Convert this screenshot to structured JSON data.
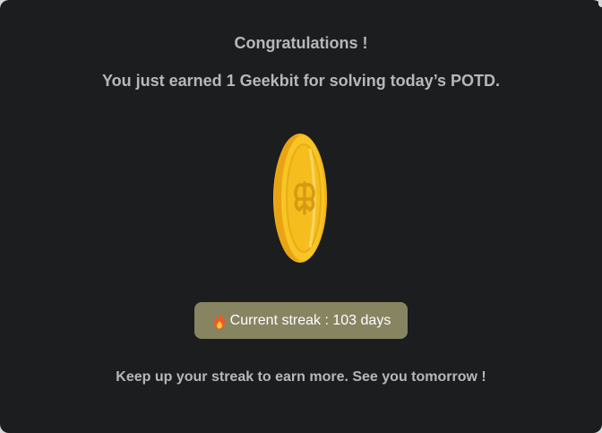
{
  "modal": {
    "title": "Congratulations !",
    "message": "You just earned 1 Geekbit for solving today’s POTD.",
    "streak_label": "Current streak : 103 days",
    "footer": "Keep up your streak to earn more. See you tomorrow !"
  },
  "icons": {
    "coin": "geekbit-coin-icon",
    "streak": "fire-icon"
  },
  "colors": {
    "background": "#1b1d1f",
    "text": "#b5b8bb",
    "badge": "#878561",
    "coin_gold": "#f2b11c"
  }
}
